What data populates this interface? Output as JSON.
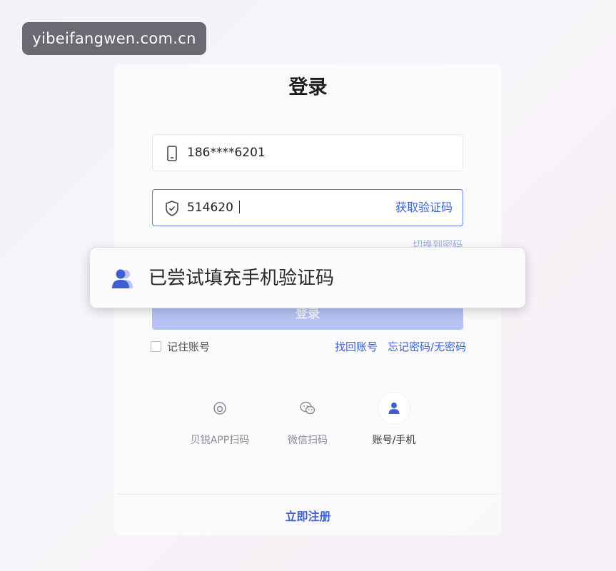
{
  "watermark": "yibeifangwen.com.cn",
  "title": "登录",
  "phone_field": {
    "value": "186****6201",
    "icon": "phone-icon"
  },
  "code_field": {
    "value": "514620",
    "icon": "shield-check-icon",
    "get_code_label": "获取验证码"
  },
  "switch_label": "切换到密码",
  "toast": {
    "text": "已尝试填充手机验证码",
    "icon": "user-group-icon"
  },
  "login_button_label": "登录",
  "remember_label": "记住账号",
  "links": {
    "find_account": "找回账号",
    "forgot_password": "忘记密码/无密码"
  },
  "login_methods": [
    {
      "label": "贝锐APP扫码",
      "icon": "scan-icon",
      "active": false
    },
    {
      "label": "微信扫码",
      "icon": "wechat-icon",
      "active": false
    },
    {
      "label": "账号/手机",
      "icon": "user-icon",
      "active": true
    }
  ],
  "register_label": "立即注册",
  "colors": {
    "accent": "#3c63cf",
    "button_disabled": "#b4c3f3",
    "watermark_bg": "#6b6a72"
  }
}
